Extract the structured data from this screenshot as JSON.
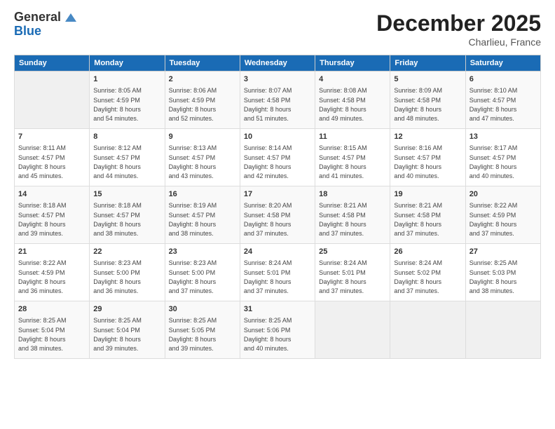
{
  "logo": {
    "general": "General",
    "blue": "Blue"
  },
  "header": {
    "month": "December 2025",
    "location": "Charlieu, France"
  },
  "weekdays": [
    "Sunday",
    "Monday",
    "Tuesday",
    "Wednesday",
    "Thursday",
    "Friday",
    "Saturday"
  ],
  "weeks": [
    [
      {
        "day": "",
        "info": ""
      },
      {
        "day": "1",
        "info": "Sunrise: 8:05 AM\nSunset: 4:59 PM\nDaylight: 8 hours\nand 54 minutes."
      },
      {
        "day": "2",
        "info": "Sunrise: 8:06 AM\nSunset: 4:59 PM\nDaylight: 8 hours\nand 52 minutes."
      },
      {
        "day": "3",
        "info": "Sunrise: 8:07 AM\nSunset: 4:58 PM\nDaylight: 8 hours\nand 51 minutes."
      },
      {
        "day": "4",
        "info": "Sunrise: 8:08 AM\nSunset: 4:58 PM\nDaylight: 8 hours\nand 49 minutes."
      },
      {
        "day": "5",
        "info": "Sunrise: 8:09 AM\nSunset: 4:58 PM\nDaylight: 8 hours\nand 48 minutes."
      },
      {
        "day": "6",
        "info": "Sunrise: 8:10 AM\nSunset: 4:57 PM\nDaylight: 8 hours\nand 47 minutes."
      }
    ],
    [
      {
        "day": "7",
        "info": "Sunrise: 8:11 AM\nSunset: 4:57 PM\nDaylight: 8 hours\nand 45 minutes."
      },
      {
        "day": "8",
        "info": "Sunrise: 8:12 AM\nSunset: 4:57 PM\nDaylight: 8 hours\nand 44 minutes."
      },
      {
        "day": "9",
        "info": "Sunrise: 8:13 AM\nSunset: 4:57 PM\nDaylight: 8 hours\nand 43 minutes."
      },
      {
        "day": "10",
        "info": "Sunrise: 8:14 AM\nSunset: 4:57 PM\nDaylight: 8 hours\nand 42 minutes."
      },
      {
        "day": "11",
        "info": "Sunrise: 8:15 AM\nSunset: 4:57 PM\nDaylight: 8 hours\nand 41 minutes."
      },
      {
        "day": "12",
        "info": "Sunrise: 8:16 AM\nSunset: 4:57 PM\nDaylight: 8 hours\nand 40 minutes."
      },
      {
        "day": "13",
        "info": "Sunrise: 8:17 AM\nSunset: 4:57 PM\nDaylight: 8 hours\nand 40 minutes."
      }
    ],
    [
      {
        "day": "14",
        "info": "Sunrise: 8:18 AM\nSunset: 4:57 PM\nDaylight: 8 hours\nand 39 minutes."
      },
      {
        "day": "15",
        "info": "Sunrise: 8:18 AM\nSunset: 4:57 PM\nDaylight: 8 hours\nand 38 minutes."
      },
      {
        "day": "16",
        "info": "Sunrise: 8:19 AM\nSunset: 4:57 PM\nDaylight: 8 hours\nand 38 minutes."
      },
      {
        "day": "17",
        "info": "Sunrise: 8:20 AM\nSunset: 4:58 PM\nDaylight: 8 hours\nand 37 minutes."
      },
      {
        "day": "18",
        "info": "Sunrise: 8:21 AM\nSunset: 4:58 PM\nDaylight: 8 hours\nand 37 minutes."
      },
      {
        "day": "19",
        "info": "Sunrise: 8:21 AM\nSunset: 4:58 PM\nDaylight: 8 hours\nand 37 minutes."
      },
      {
        "day": "20",
        "info": "Sunrise: 8:22 AM\nSunset: 4:59 PM\nDaylight: 8 hours\nand 37 minutes."
      }
    ],
    [
      {
        "day": "21",
        "info": "Sunrise: 8:22 AM\nSunset: 4:59 PM\nDaylight: 8 hours\nand 36 minutes."
      },
      {
        "day": "22",
        "info": "Sunrise: 8:23 AM\nSunset: 5:00 PM\nDaylight: 8 hours\nand 36 minutes."
      },
      {
        "day": "23",
        "info": "Sunrise: 8:23 AM\nSunset: 5:00 PM\nDaylight: 8 hours\nand 37 minutes."
      },
      {
        "day": "24",
        "info": "Sunrise: 8:24 AM\nSunset: 5:01 PM\nDaylight: 8 hours\nand 37 minutes."
      },
      {
        "day": "25",
        "info": "Sunrise: 8:24 AM\nSunset: 5:01 PM\nDaylight: 8 hours\nand 37 minutes."
      },
      {
        "day": "26",
        "info": "Sunrise: 8:24 AM\nSunset: 5:02 PM\nDaylight: 8 hours\nand 37 minutes."
      },
      {
        "day": "27",
        "info": "Sunrise: 8:25 AM\nSunset: 5:03 PM\nDaylight: 8 hours\nand 38 minutes."
      }
    ],
    [
      {
        "day": "28",
        "info": "Sunrise: 8:25 AM\nSunset: 5:04 PM\nDaylight: 8 hours\nand 38 minutes."
      },
      {
        "day": "29",
        "info": "Sunrise: 8:25 AM\nSunset: 5:04 PM\nDaylight: 8 hours\nand 39 minutes."
      },
      {
        "day": "30",
        "info": "Sunrise: 8:25 AM\nSunset: 5:05 PM\nDaylight: 8 hours\nand 39 minutes."
      },
      {
        "day": "31",
        "info": "Sunrise: 8:25 AM\nSunset: 5:06 PM\nDaylight: 8 hours\nand 40 minutes."
      },
      {
        "day": "",
        "info": ""
      },
      {
        "day": "",
        "info": ""
      },
      {
        "day": "",
        "info": ""
      }
    ]
  ]
}
